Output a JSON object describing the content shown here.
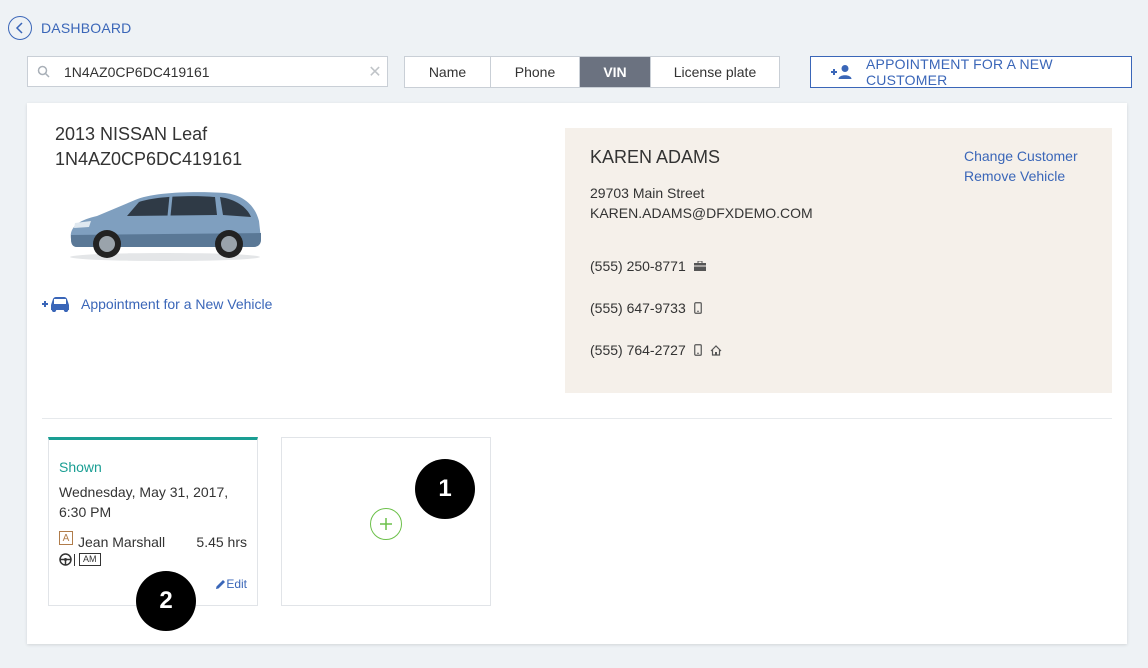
{
  "header": {
    "back_label": "DASHBOARD"
  },
  "search": {
    "value": "1N4AZ0CP6DC419161",
    "placeholder": ""
  },
  "search_by": {
    "options": [
      "Name",
      "Phone",
      "VIN",
      "License plate"
    ],
    "selected": "VIN"
  },
  "new_customer_button": {
    "label": "APPOINTMENT FOR A NEW CUSTOMER"
  },
  "vehicle": {
    "title": "2013 NISSAN Leaf",
    "vin": "1N4AZ0CP6DC419161",
    "color": "#7f9fbf",
    "new_vehicle_link": "Appointment for a New Vehicle"
  },
  "customer": {
    "name": "KAREN ADAMS",
    "address": "29703 Main Street",
    "email": "KAREN.ADAMS@DFXDEMO.COM",
    "change_link": "Change Customer",
    "remove_link": "Remove Vehicle",
    "phones": [
      {
        "number": "(555) 250-8771",
        "icons": [
          "briefcase-icon"
        ]
      },
      {
        "number": "(555) 647-9733",
        "icons": [
          "mobile-phone-icon"
        ]
      },
      {
        "number": "(555) 764-2727",
        "icons": [
          "mobile-phone-icon",
          "home-icon"
        ]
      }
    ]
  },
  "appointment": {
    "status": "Shown",
    "date_line1": "Wednesday, May 31, 2017,",
    "date_line2": "6:30 PM",
    "tech_badge": "A",
    "technician": "Jean Marshall",
    "hours": "5.45 hrs",
    "time_badge": "AM",
    "edit_label": "Edit"
  },
  "markers": [
    "1",
    "2"
  ],
  "colors": {
    "accent": "#3a66b8",
    "status": "#1a9e93",
    "add": "#6cc04a",
    "panel": "#f5f0ea"
  }
}
